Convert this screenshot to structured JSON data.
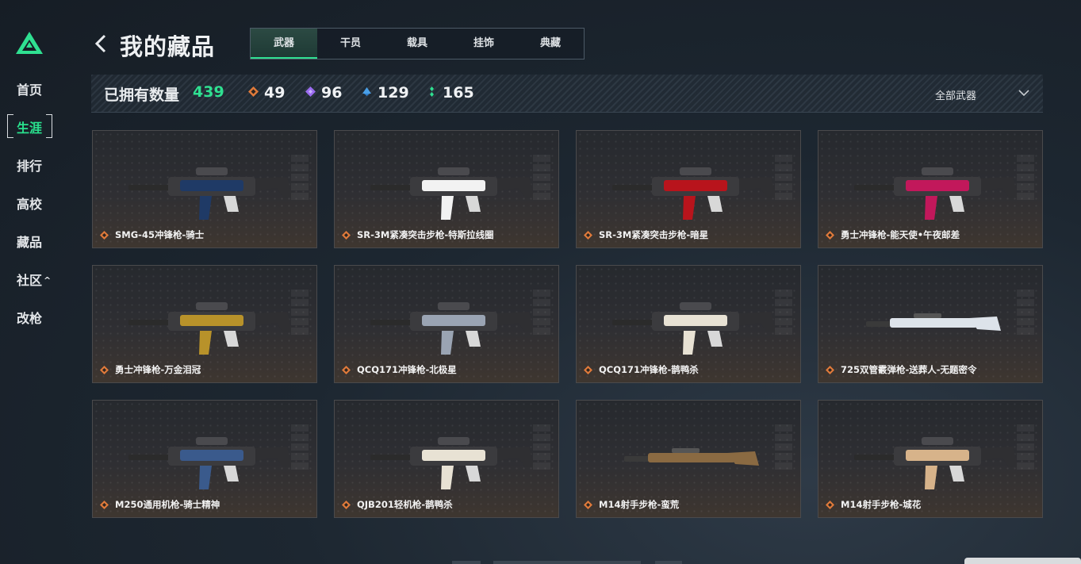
{
  "sidebar": {
    "items": [
      {
        "label": "首页"
      },
      {
        "label": "生涯"
      },
      {
        "label": "排行"
      },
      {
        "label": "高校"
      },
      {
        "label": "藏品"
      },
      {
        "label": "社区",
        "caret": "^"
      },
      {
        "label": "改枪"
      }
    ]
  },
  "header": {
    "title": "我的藏品",
    "tabs": [
      {
        "label": "武器"
      },
      {
        "label": "干员"
      },
      {
        "label": "载具"
      },
      {
        "label": "挂饰"
      },
      {
        "label": "典藏"
      }
    ]
  },
  "summary": {
    "owned_label": "已拥有数量",
    "owned_total": "439",
    "rarity_counts": [
      {
        "count": "49",
        "color": "#e07a3a",
        "icon": "orange-diamond-icon"
      },
      {
        "count": "96",
        "color": "#9b6cf0",
        "icon": "purple-diamond-icon"
      },
      {
        "count": "129",
        "color": "#4aa0e8",
        "icon": "blue-diamond-icon"
      },
      {
        "count": "165",
        "color": "#2fe091",
        "icon": "green-diamond-icon"
      }
    ],
    "filter": {
      "label": "全部武器"
    }
  },
  "cards": [
    {
      "name": "SMG-45冲锋枪-骑士",
      "accent": "#1f3a66"
    },
    {
      "name": "SR-3M紧凑突击步枪-特斯拉线圈",
      "accent": "#f2f2f2"
    },
    {
      "name": "SR-3M紧凑突击步枪-暗星",
      "accent": "#b8141c"
    },
    {
      "name": "勇士冲锋枪-能天使•午夜邮差",
      "accent": "#c2185b"
    },
    {
      "name": "勇士冲锋枪-万金泪冠",
      "accent": "#b8922a"
    },
    {
      "name": "QCQ171冲锋枪-北极星",
      "accent": "#9aa4b3"
    },
    {
      "name": "QCQ171冲锋枪-鹊鸭杀",
      "accent": "#e8e2d4"
    },
    {
      "name": "725双管霰弹枪-送葬人-无题密令",
      "accent": "#dde3ea"
    },
    {
      "name": "M250通用机枪-骑士精神",
      "accent": "#3a5a8c"
    },
    {
      "name": "QJB201轻机枪-鹊鸭杀",
      "accent": "#e8e2d4"
    },
    {
      "name": "M14射手步枪-蛮荒",
      "accent": "#8a6a42"
    },
    {
      "name": "M14射手步枪-城花",
      "accent": "#d7b38a"
    }
  ],
  "colors": {
    "accent_green": "#2fe091",
    "rarity_gold": "#e07a3a"
  }
}
